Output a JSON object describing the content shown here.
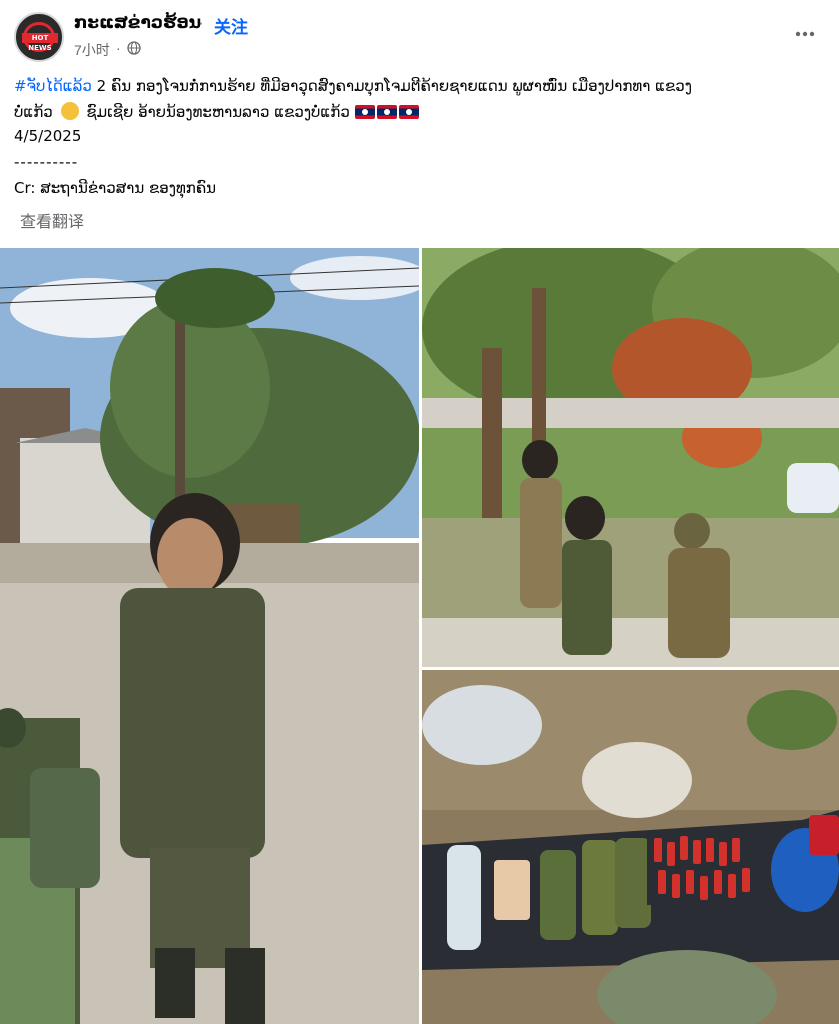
{
  "post": {
    "page_name": "ກະແສຂ່າວຮ້ອນ",
    "separator": "·",
    "follow_label": "关注",
    "time": "7小时",
    "time_sep": "·",
    "avatar_text": "HOT NEWS",
    "body": {
      "hashtag": "#ຈັບໄດ້ແລ້ວ",
      "line1_rest": " 2 ຄົນ ກອງໂຈນກໍ່ການຮ້າຍ ທີ່ມີອາວຸດສົງຄາມບຸກໂຈມຕີຄ້າຍຊາຍແດນ ພູຜາໜົ່ນ ເມືອງປາກທາ ແຂວງ",
      "line2_a": "ບໍ່ແກ້ວ",
      "line2_b": "ຊົມເຊີຍ ອ້າຍນ້ອງທະຫານລາວ ແຂວງບໍ່ແກ້ວ",
      "date": "4/5/2025",
      "divider": "----------",
      "credit": "Cr: ສະຖານີຂ່າວສານ ຂອງທຸກຄົນ"
    },
    "translate_label": "查看翻译"
  },
  "icons": {
    "globe": "globe-icon",
    "more": "more-options-icon",
    "clap": "clapping-hands-emoji",
    "flag": "laos-flag-emoji"
  },
  "colors": {
    "link": "#0866ff",
    "secondary_text": "#65676b",
    "brand_red": "#e0282e"
  }
}
